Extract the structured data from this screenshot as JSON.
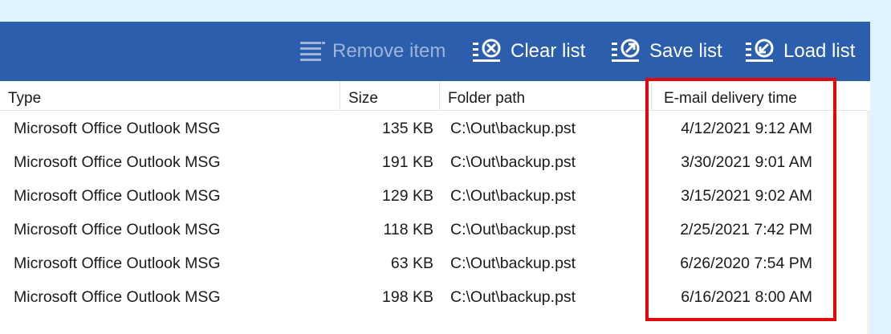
{
  "toolbar": {
    "remove_item": "Remove item",
    "clear_list": "Clear list",
    "save_list": "Save list",
    "load_list": "Load list"
  },
  "columns": {
    "type": "Type",
    "size": "Size",
    "folder_path": "Folder path",
    "delivery_time": "E-mail delivery time"
  },
  "rows": [
    {
      "type": "Microsoft Office Outlook MSG",
      "size": "135 KB",
      "path": "C:\\Out\\backup.pst",
      "time": "4/12/2021 9:12 AM"
    },
    {
      "type": "Microsoft Office Outlook MSG",
      "size": "191 KB",
      "path": "C:\\Out\\backup.pst",
      "time": "3/30/2021 9:01 AM"
    },
    {
      "type": "Microsoft Office Outlook MSG",
      "size": "129 KB",
      "path": "C:\\Out\\backup.pst",
      "time": "3/15/2021 9:02 AM"
    },
    {
      "type": "Microsoft Office Outlook MSG",
      "size": "118 KB",
      "path": "C:\\Out\\backup.pst",
      "time": "2/25/2021 7:42 PM"
    },
    {
      "type": "Microsoft Office Outlook MSG",
      "size": "63 KB",
      "path": "C:\\Out\\backup.pst",
      "time": "6/26/2020 7:54 PM"
    },
    {
      "type": "Microsoft Office Outlook MSG",
      "size": "198 KB",
      "path": "C:\\Out\\backup.pst",
      "time": "6/16/2021 8:00 AM"
    }
  ],
  "colors": {
    "toolbar_bg": "#2b5fae",
    "highlight": "#e3080c",
    "page_bg": "#dff3fd"
  }
}
